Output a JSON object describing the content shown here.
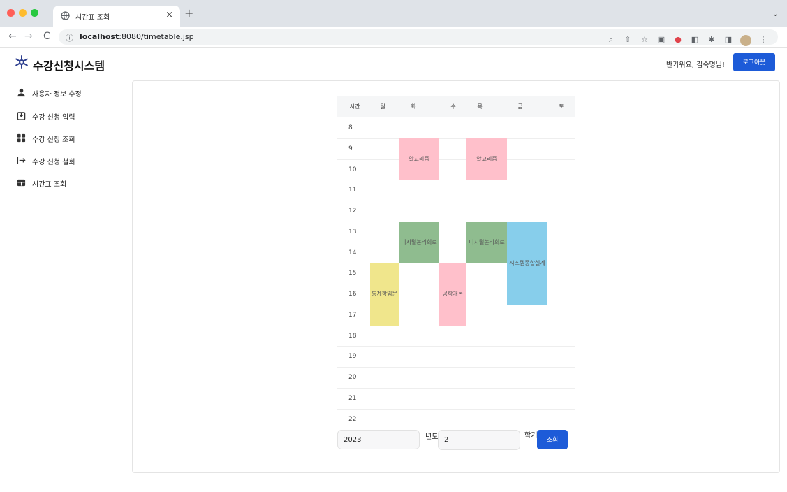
{
  "browser": {
    "tab_title": "시간표 조회",
    "tab_close": "×",
    "new_tab": "+",
    "tab_menu": "⌄",
    "url_host": "localhost",
    "url_rest": ":8080/timetable.jsp",
    "back": "←",
    "forward": "→",
    "reload": "C"
  },
  "header": {
    "app_title": "수강신청시스템",
    "greeting": "반가워요, 김숙명님!",
    "logout_label": "로그아웃"
  },
  "sidebar": {
    "items": [
      {
        "icon": "user-icon",
        "label": "사용자 정보 수정"
      },
      {
        "icon": "download-box-icon",
        "label": "수강 신청 입력"
      },
      {
        "icon": "grid-icon",
        "label": "수강 신청 조회"
      },
      {
        "icon": "arrow-out-icon",
        "label": "수강 신청 철회"
      },
      {
        "icon": "table-icon",
        "label": "시간표 조회"
      }
    ]
  },
  "timetable": {
    "headers": [
      "시간",
      "월",
      "화",
      "수",
      "목",
      "금",
      "토"
    ],
    "hours": [
      "8",
      "9",
      "10",
      "11",
      "12",
      "13",
      "14",
      "15",
      "16",
      "17",
      "18",
      "19",
      "20",
      "21",
      "22"
    ],
    "courses": [
      {
        "name": "알고리즘",
        "day": "화",
        "start": 9,
        "end": 11,
        "color": "#ffc0cb"
      },
      {
        "name": "알고리즘",
        "day": "목",
        "start": 9,
        "end": 11,
        "color": "#ffc0cb"
      },
      {
        "name": "디지털논리회로",
        "day": "화",
        "start": 13,
        "end": 15,
        "color": "#8fbc8f"
      },
      {
        "name": "디지털논리회로",
        "day": "목",
        "start": 13,
        "end": 15,
        "color": "#8fbc8f"
      },
      {
        "name": "시스템종합설계",
        "day": "금",
        "start": 13,
        "end": 17,
        "color": "#87ceeb"
      },
      {
        "name": "통계학입문",
        "day": "월",
        "start": 15,
        "end": 18,
        "color": "#f0e68c"
      },
      {
        "name": "공학개론",
        "day": "수",
        "start": 15,
        "end": 18,
        "color": "#ffc0cb"
      }
    ]
  },
  "form": {
    "year_value": "2023",
    "year_label": "년도",
    "semester_value": "2",
    "semester_label": "학기",
    "submit_label": "조회"
  }
}
